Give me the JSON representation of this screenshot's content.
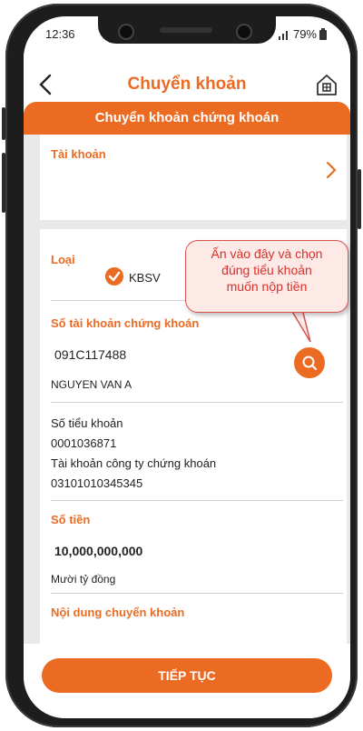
{
  "status_bar": {
    "time": "12:36",
    "battery": "79%"
  },
  "header": {
    "title": "Chuyển khoản"
  },
  "banner": {
    "title": "Chuyển khoản chứng khoán"
  },
  "account": {
    "label": "Tài khoản"
  },
  "type": {
    "label": "Loại",
    "option": "KBSV"
  },
  "tooltip": {
    "line1": "Ấn vào đây và chọn",
    "line2": "đúng tiểu khoản",
    "line3": "muốn nộp tiền"
  },
  "securities_account": {
    "label": "Số tài khoản chứng khoán",
    "number": "091C117488",
    "holder_name": "NGUYEN VAN A"
  },
  "sub_account": {
    "label": "Số tiểu khoản",
    "value": "0001036871",
    "company_label": "Tài khoản công ty chứng khoán",
    "company_value": "03101010345345"
  },
  "amount": {
    "label": "Số tiền",
    "value": "10,000,000,000",
    "in_words": "Mười tỷ đồng"
  },
  "transfer_content": {
    "label": "Nội dung chuyển khoản"
  },
  "actions": {
    "continue_label": "TIẾP TỤC"
  },
  "colors": {
    "accent": "#ec6b22",
    "tooltip_text": "#d9302a",
    "tooltip_bg": "#fde9e6"
  }
}
